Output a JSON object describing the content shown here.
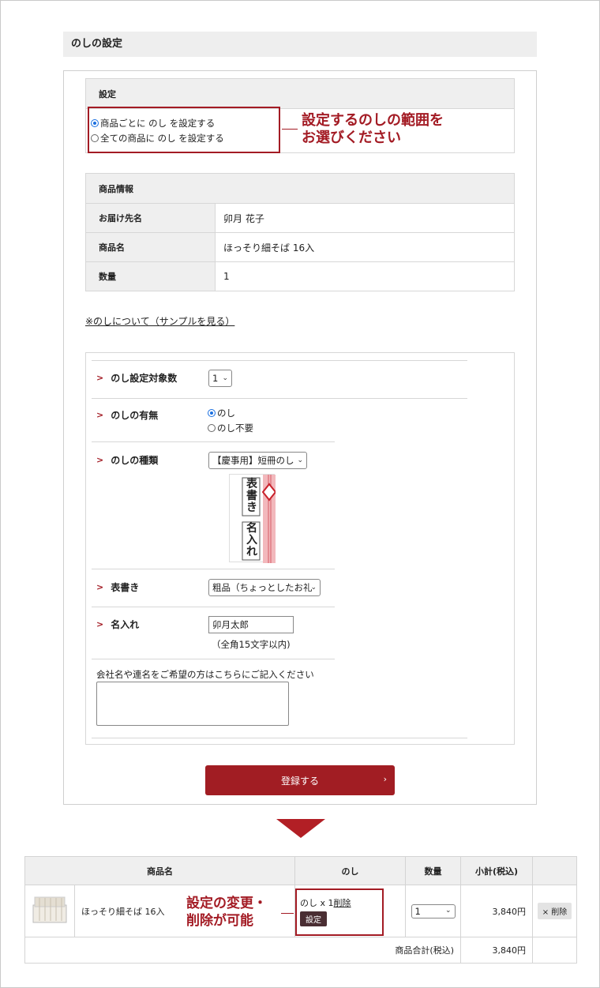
{
  "section_title": "のしの設定",
  "settings": {
    "header": "設定",
    "options": [
      {
        "label": "商品ごとに のし を設定する",
        "checked": true
      },
      {
        "label": "全ての商品に のし を設定する",
        "checked": false
      }
    ],
    "callout_line1": "設定するのしの範囲を",
    "callout_line2": "お選びください"
  },
  "product_info": {
    "header": "商品情報",
    "rows": [
      {
        "label": "お届け先名",
        "value": "卯月 花子"
      },
      {
        "label": "商品名",
        "value": "ほっそり細そば 16入"
      },
      {
        "label": "数量",
        "value": "1"
      }
    ]
  },
  "noshi_link": "※のしについて（サンプルを見る）",
  "form": {
    "count_label": "のし設定対象数",
    "count_value": "1",
    "presence_label": "のしの有無",
    "presence_options": [
      {
        "label": "のし",
        "checked": true
      },
      {
        "label": "のし不要",
        "checked": false
      }
    ],
    "type_label": "のしの種類",
    "type_value": "【慶事用】短冊のし",
    "sample_omote": [
      "表",
      "書",
      "き"
    ],
    "sample_name": [
      "名",
      "入",
      "れ"
    ],
    "omote_label": "表書き",
    "omote_value": "粗品（ちょっとしたお礼",
    "name_label": "名入れ",
    "name_value": "卯月太郎",
    "name_hint": "（全角15文字以内)",
    "comment_label": "会社名や連名をご希望の方はこちらにご記入ください",
    "submit_label": "登録する"
  },
  "cart": {
    "headers": {
      "product": "商品名",
      "noshi": "のし",
      "qty": "数量",
      "subtotal": "小計(税込)"
    },
    "item": {
      "name": "ほっそり細そば 16入",
      "noshi_text": "のし x 1",
      "delete_link": "削除",
      "settings_button": "設定",
      "qty": "1",
      "price": "3,840円",
      "remove_button": "× 削除"
    },
    "callout_line1": "設定の変更・",
    "callout_line2": "削除が可能",
    "total_label": "商品合計(税込)",
    "total_value": "3,840円"
  },
  "colors": {
    "accent": "#a31b24",
    "button": "#a11d23",
    "header_bg": "#efefef"
  }
}
